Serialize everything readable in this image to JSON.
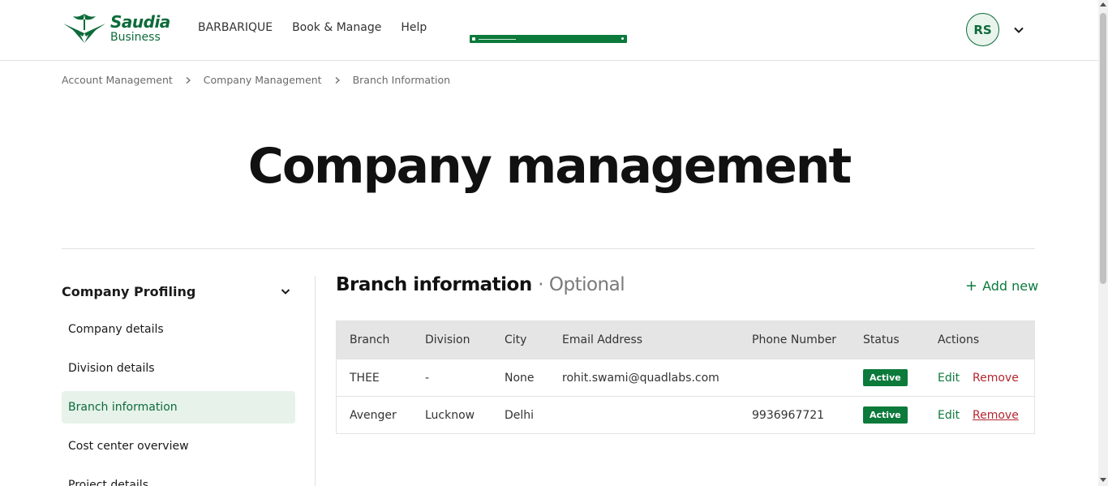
{
  "header": {
    "brand_line1": "Saudia",
    "brand_line2": "Business",
    "nav": [
      "BARBARIQUE",
      "Book & Manage",
      "Help"
    ],
    "avatar_initials": "RS"
  },
  "breadcrumb": [
    "Account Management",
    "Company Management",
    "Branch Information"
  ],
  "page_title": "Company management",
  "sidebar": {
    "section_title": "Company Profiling",
    "items": [
      {
        "label": "Company details",
        "active": false
      },
      {
        "label": "Division details",
        "active": false
      },
      {
        "label": "Branch information",
        "active": true
      },
      {
        "label": "Cost center overview",
        "active": false
      },
      {
        "label": "Project details",
        "active": false
      }
    ]
  },
  "section": {
    "title": "Branch information",
    "optional": "· Optional",
    "add_new": "Add new"
  },
  "table": {
    "columns": [
      "Branch",
      "Division",
      "City",
      "Email Address",
      "Phone Number",
      "Status",
      "Actions"
    ],
    "rows": [
      {
        "branch": "THEE",
        "division": "-",
        "city": "None",
        "email": "rohit.swami@quadlabs.com",
        "phone": "",
        "status": "Active",
        "edit": "Edit",
        "remove": "Remove"
      },
      {
        "branch": "Avenger",
        "division": "Lucknow",
        "city": "Delhi",
        "email": "",
        "phone": "9936967721",
        "status": "Active",
        "edit": "Edit",
        "remove": "Remove"
      }
    ]
  },
  "colors": {
    "brand_green": "#0d6b3a",
    "badge_green": "#0b7a3b",
    "remove_red": "#b3262d"
  }
}
